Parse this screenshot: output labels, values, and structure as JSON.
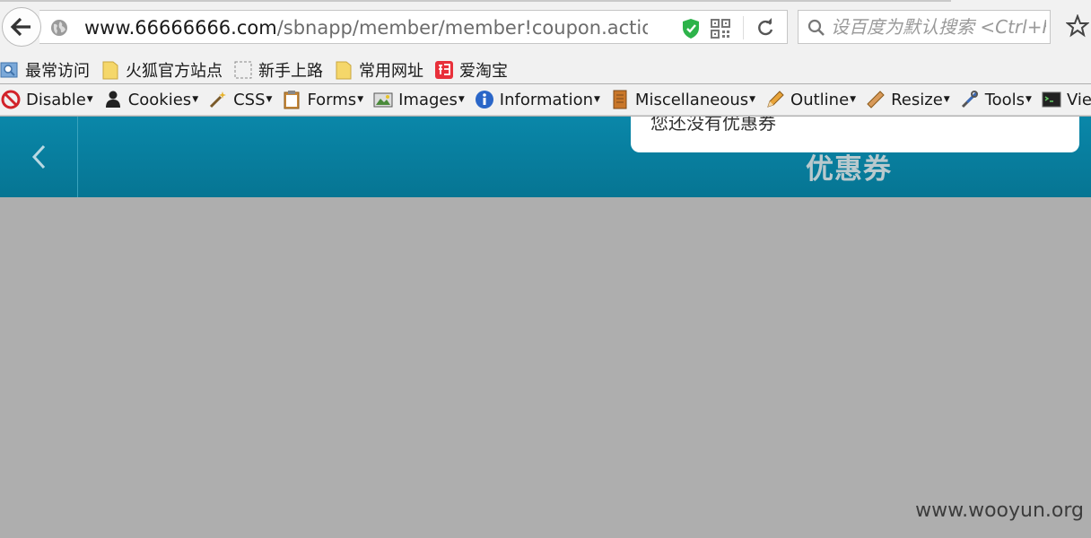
{
  "browser": {
    "url_host": "www.66666666.com",
    "url_path": "/sbnapp/member/member!coupon.action?p",
    "search_placeholder": "设百度为默认搜索 <Ctrl+K>"
  },
  "bookmarks": [
    {
      "label": "最常访问",
      "icon": "most-visited-icon"
    },
    {
      "label": "火狐官方站点",
      "icon": "folder-icon"
    },
    {
      "label": "新手上路",
      "icon": "dashed-page-icon"
    },
    {
      "label": "常用网址",
      "icon": "folder-icon"
    },
    {
      "label": "爱淘宝",
      "icon": "taobao-icon"
    }
  ],
  "devtoolbar": [
    {
      "label": "Disable",
      "icon": "disable-icon"
    },
    {
      "label": "Cookies",
      "icon": "cookies-icon"
    },
    {
      "label": "CSS",
      "icon": "css-wand-icon"
    },
    {
      "label": "Forms",
      "icon": "forms-clipboard-icon"
    },
    {
      "label": "Images",
      "icon": "images-icon"
    },
    {
      "label": "Information",
      "icon": "information-icon"
    },
    {
      "label": "Miscellaneous",
      "icon": "miscellaneous-icon"
    },
    {
      "label": "Outline",
      "icon": "outline-pencil-icon"
    },
    {
      "label": "Resize",
      "icon": "resize-ruler-icon"
    },
    {
      "label": "Tools",
      "icon": "tools-icon"
    },
    {
      "label": "View",
      "icon": "view-source-icon"
    }
  ],
  "page": {
    "title": "优惠券",
    "toast": "您还没有优惠券"
  },
  "watermark": "www.wooyun.org",
  "colors": {
    "header": "#067f9f",
    "page_bg": "#aeaeae"
  }
}
